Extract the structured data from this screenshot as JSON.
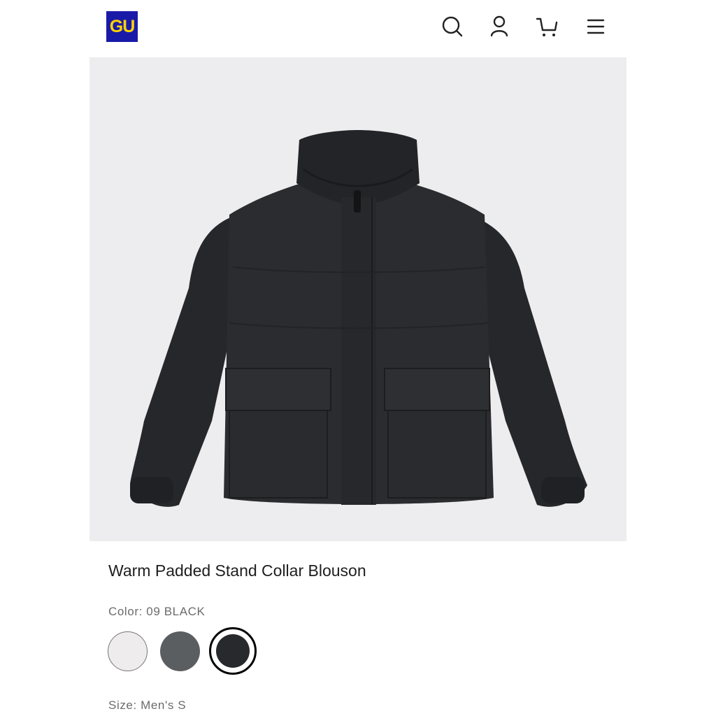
{
  "header": {
    "logo_text": "GU",
    "brand_color": "#1a1aa8",
    "logo_text_color": "#ffd400",
    "icons": [
      "search-icon",
      "account-icon",
      "cart-icon",
      "menu-icon"
    ]
  },
  "product": {
    "image": "black padded stand collar blouson jacket",
    "image_background": "#ededef",
    "title": "Warm Padded Stand Collar Blouson",
    "color_label": "Color: 09 BLACK",
    "swatches": [
      {
        "name": "white",
        "hex": "#efeced",
        "selected": false
      },
      {
        "name": "gray",
        "hex": "#5b5e61",
        "selected": false
      },
      {
        "name": "black",
        "hex": "#27292d",
        "selected": true
      }
    ],
    "size_label": "Size: Men's S"
  }
}
